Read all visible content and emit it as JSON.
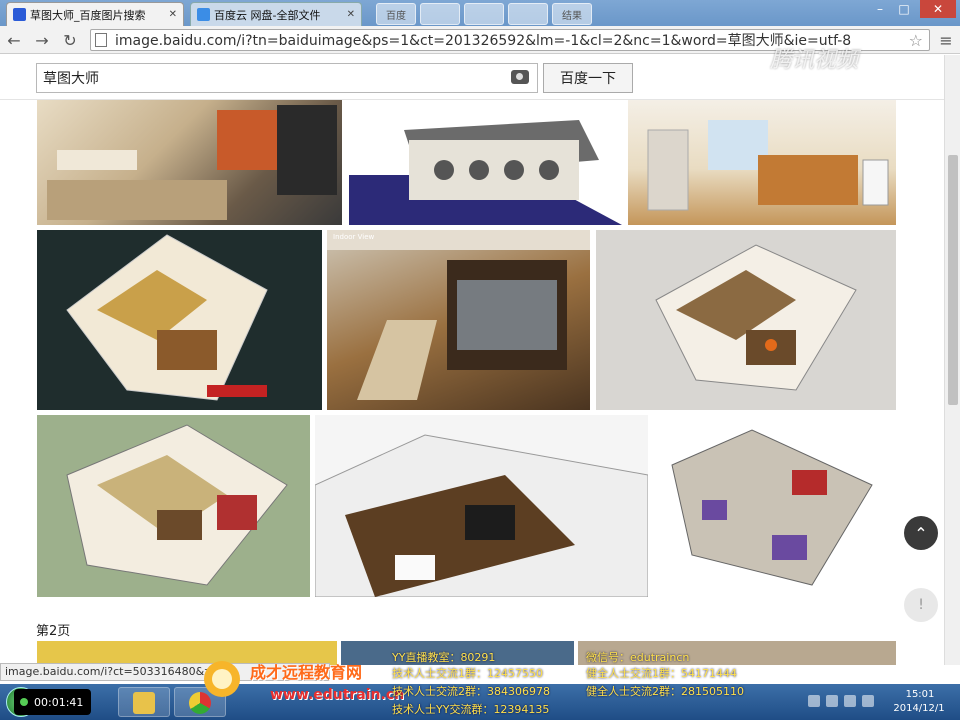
{
  "tabs": [
    {
      "label": "草图大师_百度图片搜索",
      "active": true
    },
    {
      "label": "百度云 网盘-全部文件",
      "active": false
    }
  ],
  "ghost_tabs": [
    "百度",
    "",
    "",
    "",
    "",
    "结果"
  ],
  "address_bar": {
    "url": "image.baidu.com/i?tn=baiduimage&ps=1&ct=201326592&lm=-1&cl=2&nc=1&word=草图大师&ie=utf-8"
  },
  "search": {
    "query": "草图大师",
    "button_label": "百度一下"
  },
  "results": [
    {
      "caption": "",
      "bg": "#5a5046"
    },
    {
      "caption": "",
      "bg": "#2a2a6a"
    },
    {
      "caption": "",
      "bg": "#c79a5a"
    },
    {
      "caption": "",
      "bg": "#1f2f2f"
    },
    {
      "caption": "Indoor View",
      "bg": "#7d5a36"
    },
    {
      "caption": "",
      "bg": "#8a7252"
    },
    {
      "caption": "",
      "bg": "#98ad88"
    },
    {
      "caption": "",
      "bg": "#5c3e22"
    },
    {
      "caption": "",
      "bg": "#c9c2b5"
    }
  ],
  "page_label": "第2页",
  "status_url": "image.baidu.com/i?ct=503316480&z=",
  "watermark": {
    "brand": "腾讯视频"
  },
  "edu": {
    "title": "成才远程教育网",
    "url": "www.edutrain.cn",
    "info_left": [
      "YY直播教室：80291",
      "技术人士交流1群：12457550",
      "技术人士交流2群：384306978",
      "技术人士YY交流群：12394135"
    ],
    "info_right": [
      "微信号：edutraincn",
      "健全人士交流1群：54171444",
      "健全人士交流2群：281505110"
    ]
  },
  "taskbar": {
    "timer": "00:01:41",
    "time": "15:01",
    "date": "2014/12/1"
  }
}
